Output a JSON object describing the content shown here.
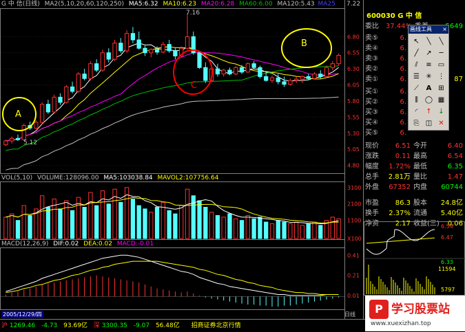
{
  "header": {
    "stock_name": "G 中 信(日线)",
    "ma_title": "MA2(5,10,20,60,120,250)",
    "ma5": "MA5:6.32",
    "ma10": "MA10:6.23",
    "ma20": "MA20:6.28",
    "ma60": "MA60:6.00",
    "ma120": "MA120:5.43",
    "ma250": "MA25",
    "corner_price": "7.22"
  },
  "annotations": {
    "a": "A",
    "b": "B",
    "c": "C",
    "high": "7.16",
    "low": "5.12"
  },
  "price_axis": [
    "6.80",
    "6.55",
    "6.30",
    "6.05",
    "5.80",
    "5.55",
    "5.30",
    "5.05",
    "4.80"
  ],
  "volume": {
    "title": "VOL(5,10)",
    "volume": "VOLUME:128096.00",
    "ma5": "MA5:103038.84",
    "mavol2": "MAVOL2:107756.64",
    "axis": [
      "3100",
      "2100",
      "1100",
      "X100"
    ]
  },
  "macd": {
    "title": "MACD(12,26,9)",
    "dif": "DIF:0.02",
    "dea": "DEA:0.02",
    "macd": "MACD:-0.01",
    "axis": [
      "0.41",
      "0.21",
      "0.01"
    ]
  },
  "date_label": "2005/12/29/四",
  "tab_label": "日线",
  "quote_panel": {
    "code_title": "600030 G 中 信",
    "webi_label": "委比",
    "webi_value": "37.44%",
    "wecha_label": "委差",
    "wecha_value": "-5649",
    "sell": [
      {
        "label": "卖⑤",
        "price": "6."
      },
      {
        "label": "卖④",
        "price": "6."
      },
      {
        "label": "卖③",
        "price": "6."
      },
      {
        "label": "卖②",
        "price": "6."
      },
      {
        "label": "卖①",
        "price": "6."
      }
    ],
    "sell_vol_partial": [
      "",
      "",
      "",
      "",
      "87"
    ],
    "buy": [
      {
        "label": "买①",
        "price": "6."
      },
      {
        "label": "买②",
        "price": "6."
      },
      {
        "label": "买③",
        "price": "6."
      },
      {
        "label": "买④",
        "price": "6."
      },
      {
        "label": "买⑤",
        "price": "6."
      }
    ],
    "stats": [
      {
        "l1": "现价",
        "v1": "6.51",
        "l2": "今开",
        "v2": "6.40"
      },
      {
        "l1": "涨跌",
        "v1": "0.11",
        "l2": "最高",
        "v2": "6.54"
      },
      {
        "l1": "幅度",
        "v1": "1.72%",
        "l2": "最低",
        "v2": "6.35"
      },
      {
        "l1": "总手",
        "v1": "2.81万",
        "l2": "量比",
        "v2": "1.47"
      },
      {
        "l1": "外盘",
        "v1": "67352",
        "l2": "内盘",
        "v2": "60744"
      },
      {
        "l1": "市盈",
        "v1": "86.3",
        "l2": "股本",
        "v2": "24.8亿"
      },
      {
        "l1": "换手",
        "v1": "2.37%",
        "l2": "流通",
        "v2": "5.40亿"
      },
      {
        "l1": "净资",
        "v1": "2.17",
        "l2": "收益(三)",
        "v2": "0.06"
      }
    ]
  },
  "toolbox": {
    "title": "画线工具",
    "close": "×",
    "text_tool": "A"
  },
  "mini_chart": {
    "axis": [
      "6.54",
      "6.47",
      "6.33",
      "11594",
      "5797"
    ]
  },
  "status_bar": {
    "sh_label": "沪",
    "sh_value": "1269.46",
    "sh_change": "-4.73",
    "sh_amount": "93.69亿",
    "sz_label": "深",
    "sz_value": "3300.35",
    "sz_change": "-9.07",
    "sz_amount": "56.48亿",
    "broker": "招商证券北京行情"
  },
  "watermark": {
    "name": "学习股票站",
    "url": "www.xuexizhan.top"
  },
  "colors": {
    "up": "#ff3232",
    "down": "#54ffff",
    "ma5": "#ffffff",
    "ma10": "#ffff00",
    "ma20": "#ff00ff",
    "ma60": "#00c000",
    "ma120": "#c0c0c0",
    "annotation_a": "#ffff00",
    "annotation_b": "#ffff00",
    "annotation_c": "#ff0000"
  },
  "chart_data": {
    "type": "candlestick",
    "ylim": [
      4.7,
      7.22
    ],
    "candles": [
      [
        5.12,
        5.2,
        5.1,
        5.18
      ],
      [
        5.18,
        5.25,
        5.14,
        5.22
      ],
      [
        5.22,
        5.28,
        5.18,
        5.2
      ],
      [
        5.2,
        5.45,
        5.18,
        5.42
      ],
      [
        5.42,
        5.48,
        5.35,
        5.38
      ],
      [
        5.38,
        5.5,
        5.36,
        5.47
      ],
      [
        5.47,
        5.78,
        5.44,
        5.75
      ],
      [
        5.75,
        5.82,
        5.6,
        5.63
      ],
      [
        5.63,
        5.9,
        5.6,
        5.86
      ],
      [
        5.86,
        5.92,
        5.74,
        5.78
      ],
      [
        5.78,
        6.05,
        5.76,
        6.02
      ],
      [
        6.02,
        6.1,
        5.92,
        5.95
      ],
      [
        5.95,
        6.25,
        5.93,
        6.22
      ],
      [
        6.22,
        6.3,
        6.12,
        6.15
      ],
      [
        6.15,
        6.42,
        6.12,
        6.38
      ],
      [
        6.38,
        6.45,
        6.25,
        6.28
      ],
      [
        6.28,
        6.6,
        6.25,
        6.55
      ],
      [
        6.55,
        6.62,
        6.4,
        6.45
      ],
      [
        6.45,
        6.75,
        6.42,
        6.7
      ],
      [
        6.7,
        6.78,
        6.55,
        6.58
      ],
      [
        6.58,
        6.9,
        6.55,
        6.85
      ],
      [
        6.85,
        6.95,
        6.7,
        6.75
      ],
      [
        6.75,
        6.88,
        6.6,
        6.62
      ],
      [
        6.62,
        6.66,
        6.5,
        6.55
      ],
      [
        6.55,
        6.62,
        6.48,
        6.6
      ],
      [
        6.6,
        6.65,
        6.52,
        6.56
      ],
      [
        6.56,
        6.72,
        6.54,
        6.68
      ],
      [
        6.68,
        6.75,
        6.55,
        6.58
      ],
      [
        6.58,
        6.62,
        6.45,
        6.5
      ],
      [
        6.5,
        6.65,
        6.48,
        6.62
      ],
      [
        6.62,
        7.16,
        6.6,
        6.8
      ],
      [
        6.8,
        6.88,
        6.52,
        6.55
      ],
      [
        6.55,
        6.58,
        6.3,
        6.32
      ],
      [
        6.32,
        6.4,
        6.08,
        6.12
      ],
      [
        6.12,
        6.35,
        6.1,
        6.3
      ],
      [
        6.3,
        6.38,
        6.18,
        6.22
      ],
      [
        6.22,
        6.3,
        6.18,
        6.28
      ],
      [
        6.28,
        6.32,
        6.2,
        6.22
      ],
      [
        6.22,
        6.35,
        6.2,
        6.32
      ],
      [
        6.32,
        6.36,
        6.22,
        6.25
      ],
      [
        6.25,
        6.4,
        6.24,
        6.38
      ],
      [
        6.38,
        6.42,
        6.3,
        6.32
      ],
      [
        6.32,
        6.35,
        6.15,
        6.18
      ],
      [
        6.18,
        6.25,
        6.1,
        6.12
      ],
      [
        6.12,
        6.2,
        6.08,
        6.16
      ],
      [
        6.16,
        6.22,
        6.06,
        6.1
      ],
      [
        6.1,
        6.18,
        6.02,
        6.06
      ],
      [
        6.06,
        6.15,
        6.04,
        6.12
      ],
      [
        6.12,
        6.18,
        6.08,
        6.14
      ],
      [
        6.14,
        6.2,
        6.08,
        6.18
      ],
      [
        6.18,
        6.22,
        6.12,
        6.15
      ],
      [
        6.15,
        6.25,
        6.14,
        6.22
      ],
      [
        6.22,
        6.28,
        6.15,
        6.18
      ],
      [
        6.18,
        6.35,
        6.16,
        6.32
      ],
      [
        6.32,
        6.42,
        6.28,
        6.38
      ],
      [
        6.38,
        6.54,
        6.35,
        6.51
      ]
    ],
    "volume": [
      1300,
      1500,
      1100,
      2000,
      1400,
      1800,
      2600,
      1900,
      2400,
      1800,
      2300,
      1700,
      2500,
      1900,
      2800,
      2000,
      2900,
      2100,
      3000,
      2200,
      3100,
      2400,
      2000,
      1800,
      1600,
      1900,
      2200,
      1700,
      1500,
      2000,
      3000,
      2600,
      2300,
      1900,
      1600,
      1400,
      1300,
      1500,
      1200,
      1100,
      1400,
      1200,
      1300,
      1000,
      900,
      1100,
      1000,
      900,
      1000,
      800,
      900,
      1000,
      800,
      1100,
      1300,
      1200
    ],
    "macd_bars": [
      0.02,
      0.04,
      0.05,
      0.07,
      0.08,
      0.1,
      0.12,
      0.13,
      0.14,
      0.15,
      0.16,
      0.17,
      0.18,
      0.19,
      0.2,
      0.21,
      0.2,
      0.19,
      0.18,
      0.17,
      0.16,
      0.15,
      0.14,
      0.12,
      0.1,
      0.08,
      0.07,
      0.06,
      0.05,
      0.04,
      0.05,
      0.03,
      0.01,
      -0.01,
      -0.02,
      -0.03,
      -0.04,
      -0.05,
      -0.06,
      -0.07,
      -0.08,
      -0.08,
      -0.09,
      -0.09,
      -0.1,
      -0.1,
      -0.09,
      -0.09,
      -0.08,
      -0.07,
      -0.06,
      -0.05,
      -0.04,
      -0.03,
      -0.02,
      -0.01
    ],
    "dif_line": [
      0.05,
      0.07,
      0.09,
      0.11,
      0.13,
      0.15,
      0.18,
      0.2,
      0.22,
      0.24,
      0.26,
      0.28,
      0.3,
      0.32,
      0.34,
      0.36,
      0.38,
      0.39,
      0.4,
      0.41,
      0.41,
      0.4,
      0.39,
      0.37,
      0.35,
      0.33,
      0.31,
      0.29,
      0.27,
      0.25,
      0.24,
      0.22,
      0.19,
      0.17,
      0.15,
      0.13,
      0.12,
      0.1,
      0.09,
      0.08,
      0.07,
      0.06,
      0.05,
      0.04,
      0.03,
      0.02,
      0.02,
      0.01,
      0.01,
      0.01,
      0.01,
      0.01,
      0.01,
      0.02,
      0.02,
      0.02
    ],
    "dea_line": [
      0.04,
      0.05,
      0.06,
      0.08,
      0.09,
      0.11,
      0.12,
      0.14,
      0.16,
      0.17,
      0.19,
      0.21,
      0.22,
      0.24,
      0.26,
      0.27,
      0.29,
      0.3,
      0.32,
      0.33,
      0.34,
      0.35,
      0.35,
      0.35,
      0.35,
      0.35,
      0.34,
      0.33,
      0.32,
      0.31,
      0.3,
      0.29,
      0.27,
      0.26,
      0.24,
      0.22,
      0.21,
      0.19,
      0.17,
      0.16,
      0.14,
      0.13,
      0.11,
      0.1,
      0.09,
      0.07,
      0.06,
      0.05,
      0.04,
      0.04,
      0.03,
      0.03,
      0.02,
      0.02,
      0.02,
      0.02
    ],
    "vol_ylim": [
      0,
      3300
    ],
    "macd_ylim": [
      -0.12,
      0.46
    ]
  }
}
